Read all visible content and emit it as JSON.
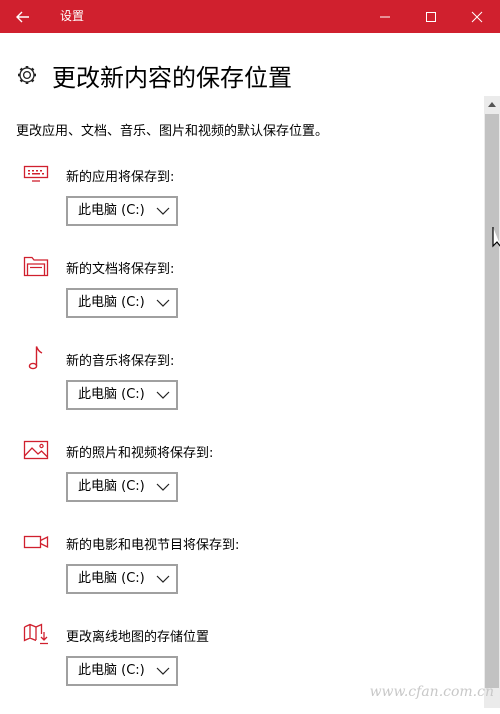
{
  "window": {
    "title": "设置",
    "back_icon": "arrow-left-icon",
    "controls": [
      "minimize-icon",
      "maximize-icon",
      "close-icon"
    ],
    "accent_color": "#d0202e"
  },
  "page": {
    "icon": "gear-icon",
    "title": "更改新内容的保存位置",
    "description": "更改应用、文档、音乐、图片和视频的默认保存位置。"
  },
  "sections": [
    {
      "icon": "monitor-icon",
      "label": "新的应用将保存到:",
      "value": "此电脑 (C:)"
    },
    {
      "icon": "folder-icon",
      "label": "新的文档将保存到:",
      "value": "此电脑 (C:)"
    },
    {
      "icon": "music-note-icon",
      "label": "新的音乐将保存到:",
      "value": "此电脑 (C:)"
    },
    {
      "icon": "picture-icon",
      "label": "新的照片和视频将保存到:",
      "value": "此电脑 (C:)"
    },
    {
      "icon": "video-camera-icon",
      "label": "新的电影和电视节目将保存到:",
      "value": "此电脑 (C:)"
    },
    {
      "icon": "map-download-icon",
      "label": "更改离线地图的存储位置",
      "value": "此电脑 (C:)"
    }
  ],
  "watermark": "www.cfan.com.cn"
}
